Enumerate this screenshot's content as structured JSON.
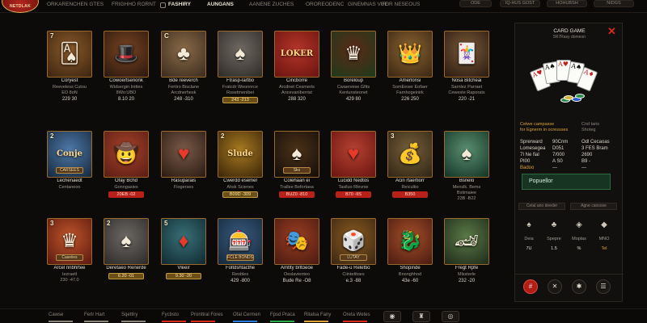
{
  "topbar": {
    "logo_text": "NETDLAK",
    "nav": [
      "ORKARENCHEN GTES",
      "FRIGHHO RORNT",
      "FASHIRY",
      "AUNGANS",
      "AANENE ZUCHES",
      "OROREODENC",
      "GINEMNAS VUE",
      "FOR NESEOUS"
    ],
    "right_pills": [
      "ODE",
      "IQ-HUS GOST",
      "HOHUBSH",
      "NIDGS"
    ]
  },
  "games": [
    {
      "num": "7",
      "art": "🂡",
      "cap": "",
      "title": "Coryest",
      "sub": [
        "Reeveless Cutou",
        "EO 8oN"
      ],
      "price": "229  30",
      "bg": [
        "#3d2410",
        "#8a5a2a"
      ],
      "style": "plain"
    },
    {
      "num": "",
      "art": "🎩",
      "cap": "",
      "title": "Cowoertsenonk",
      "sub": [
        "Widsergin Inittes",
        "8Wo:UBO"
      ],
      "price": "8.10  20",
      "bg": [
        "#2a1810",
        "#7a4420"
      ],
      "style": "plain"
    },
    {
      "num": "C",
      "art": "♣",
      "cap": "",
      "title": "Bde reeverch",
      "sub": [
        "Fertiro Bisclane",
        "Arcdnerhesk"
      ],
      "price": "248  -310",
      "bg": [
        "#3b2c1e",
        "#8a6a48"
      ],
      "style": "plain"
    },
    {
      "num": "",
      "art": "♠",
      "cap": "",
      "title": "Ftrasp-lartbo",
      "sub": [
        "Fratcdr Weonnrce",
        "Rosetmenibet"
      ],
      "price": "243  -213",
      "bg": [
        "#2e2a26",
        "#6f6a62"
      ],
      "style": "gold"
    },
    {
      "num": "",
      "art": "LOKER",
      "cap": "",
      "title": "Cincborre",
      "sub": [
        "Arcdnet Cesmerts",
        "Ancevaniberrist"
      ],
      "price": "288  320",
      "bg": [
        "#6a140f",
        "#b5352a"
      ],
      "style": "plain"
    },
    {
      "num": "",
      "art": "♛",
      "cap": "",
      "title": "Boreloup",
      "sub": [
        "Cwaervese Gfits",
        "Kenlunsteonet"
      ],
      "price": "429  80",
      "bg": [
        "#1f3a1a",
        "#5a2a18"
      ],
      "style": "plain"
    },
    {
      "num": "",
      "art": "👑",
      "cap": "",
      "title": "Amerlonsi",
      "sub": [
        "SomEeser Eofaer",
        "Farnhogeinirk"
      ],
      "price": "226  250",
      "bg": [
        "#3a2612",
        "#8a6432"
      ],
      "style": "plain"
    },
    {
      "num": "",
      "art": "🃏",
      "cap": "",
      "title": "Nosa Bitcheai",
      "sub": [
        "Sarnlez Parraet",
        "Ceweste Raporats"
      ],
      "price": "220  -21",
      "bg": [
        "#2a1a10",
        "#7a5a38"
      ],
      "style": "plain"
    },
    {
      "num": "2",
      "art": "Conje",
      "cap": "CARSEES",
      "title": "Lechenaedt",
      "sub": [
        "Centaneoo"
      ],
      "price": "",
      "bg": [
        "#14283d",
        "#4f79a8"
      ],
      "style": "plain"
    },
    {
      "num": "",
      "art": "🤠",
      "cap": "",
      "title": "Ofay Bchd",
      "sub": [
        "Gonngasies"
      ],
      "price": "20EB  -02",
      "bg": [
        "#5a1c14",
        "#a5432a"
      ],
      "style": "red"
    },
    {
      "num": "",
      "art": "♥",
      "cap": "",
      "title": "Rasuparais",
      "sub": [
        "Fiogerses"
      ],
      "price": "",
      "bg": [
        "#2a1a12",
        "#7a5a48"
      ],
      "style": "plain"
    },
    {
      "num": "2",
      "art": "Slude",
      "cap": "",
      "title": "Cwerdd esemel",
      "sub": [
        "Ahsk Scienes"
      ],
      "price": "B09D  -309",
      "bg": [
        "#3a2508",
        "#a87a20"
      ],
      "style": "gold"
    },
    {
      "num": "",
      "art": "♠",
      "cap": "Sko",
      "title": "Colehaan ei",
      "sub": [
        "Trallee Befortasa"
      ],
      "price": "BUZ0  -810",
      "bg": [
        "#140d08",
        "#4a3218"
      ],
      "style": "red"
    },
    {
      "num": "",
      "art": "♥",
      "cap": "",
      "title": "Lucidd Nedtos",
      "sub": [
        "Tasiluo Rlevnie"
      ],
      "price": "B70  -IIS",
      "bg": [
        "#6a1410",
        "#b54232"
      ],
      "style": "red"
    },
    {
      "num": "3",
      "art": "💰",
      "cap": "",
      "title": "Acin rtaertiorr",
      "sub": [
        "Reicultio"
      ],
      "price": "B350",
      "bg": [
        "#2e2414",
        "#78603a"
      ],
      "style": "red"
    },
    {
      "num": "",
      "art": "♠",
      "cap": "",
      "title": "Bsnelo",
      "sub": [
        "Menslk. Bems",
        "Bxtimaiee",
        "23B  -B22"
      ],
      "price": "",
      "bg": [
        "#143324",
        "#5a8f70"
      ],
      "style": "plain"
    },
    {
      "num": "3",
      "art": "♛",
      "cap": "Caseiies",
      "title": "Arcel nnbhrtee",
      "sub": [
        "Iezraetl",
        "230  -47.0"
      ],
      "price": "",
      "bg": [
        "#5a1810",
        "#c0552a"
      ],
      "style": "plain"
    },
    {
      "num": "2",
      "art": "♠",
      "cap": "",
      "title": "Deretaeo Renerde",
      "sub": [],
      "price": "6.20  -01",
      "bg": [
        "#2c2a28",
        "#6c6864"
      ],
      "style": "gold"
    },
    {
      "num": "5",
      "art": "♦",
      "cap": "",
      "title": "Vleeir",
      "sub": [],
      "price": "9.30  -20",
      "bg": [
        "#0f2a2e",
        "#3a6f78"
      ],
      "style": "gold"
    },
    {
      "num": "",
      "art": "🎰",
      "cap": "FCLE BONDS",
      "title": "Foltdshtacthe",
      "sub": [
        "Reobles"
      ],
      "price": "429  -800",
      "bg": [
        "#142838",
        "#3a5a80"
      ],
      "style": "plain"
    },
    {
      "num": "",
      "art": "🎭",
      "cap": "",
      "title": "Amtlty brltoeoe",
      "sub": [
        "Oeslavienteo"
      ],
      "price": "Bude  Re  -O8",
      "bg": [
        "#4a1a10",
        "#9a3e22"
      ],
      "style": "plain"
    },
    {
      "num": "",
      "art": "🎲",
      "cap": "LUTAY",
      "title": "Fade-u Relettio",
      "sub": [
        "Ciintetitoes"
      ],
      "price": "e.3  -88",
      "bg": [
        "#3a2612",
        "#8a5a20"
      ],
      "style": "plain"
    },
    {
      "num": "",
      "art": "🐉",
      "cap": "",
      "title": "Shopinde",
      "sub": [
        "Bnonghhod"
      ],
      "price": "43e  -60",
      "bg": [
        "#4a1a10",
        "#a5502a"
      ],
      "style": "plain"
    },
    {
      "num": "",
      "art": "🏎",
      "cap": "",
      "title": "Fregt Rpfe",
      "sub": [
        "Mlssterle"
      ],
      "price": "232  -20",
      "bg": [
        "#1f2a18",
        "#5a7a48"
      ],
      "style": "plain"
    }
  ],
  "panel": {
    "title": "CARD GAME",
    "subtitle": "5R7Rasy domeon",
    "close": "✕",
    "cards": [
      "A♥",
      "A♠",
      "A♥",
      "A♠",
      "A♦"
    ],
    "info_left": [
      "Cetwe campasse",
      "for Egnerm in ocressses"
    ],
    "info_right": [
      "Cnd taris",
      "Shoteg"
    ],
    "stats": [
      [
        "Sprerward",
        "90Cnm",
        "Odl Cecaoas"
      ],
      [
        "Lomesegea",
        "D051",
        "3 FES Bram"
      ],
      [
        "7I Ne fial",
        "7/000",
        "2690"
      ],
      [
        "PI00",
        "A S0",
        "B9 -"
      ],
      [
        "Badoo",
        "—",
        "—"
      ]
    ],
    "play_label": "Popuellor",
    "tabs": [
      "Cetal ano deeder",
      "Agne cansose"
    ],
    "features": [
      {
        "icon": "♠",
        "label": "Deia",
        "value": "7U"
      },
      {
        "icon": "♣",
        "label": "Spepre",
        "value": "1.5"
      },
      {
        "icon": "◈",
        "label": "Moplas",
        "value": "%"
      },
      {
        "icon": "◆",
        "label": "MNO",
        "value": "Tel"
      }
    ],
    "actions": [
      "#",
      "✕",
      "✱",
      "☰"
    ]
  },
  "bottombar": {
    "items": [
      {
        "label": "Cawse",
        "color": "#8c8478"
      },
      {
        "label": "Ferlr Hart",
        "color": "#8c8478"
      },
      {
        "label": "Sqettlry",
        "color": "#8c8478"
      },
      {
        "label": "Fycbsto",
        "color": "#d8291f"
      },
      {
        "label": "Pronttral Fores",
        "color": "#d8291f"
      },
      {
        "label": "Ofal Cermen",
        "color": "#2a7ad8"
      },
      {
        "label": "Fpsd Praca",
        "color": "#2aa84a"
      },
      {
        "label": "Ritalsa Fany",
        "color": "#d9a23a"
      },
      {
        "label": "Oreta Wetes",
        "color": "#d8291f"
      }
    ],
    "icons": [
      "◉",
      "♜",
      "◎"
    ]
  }
}
